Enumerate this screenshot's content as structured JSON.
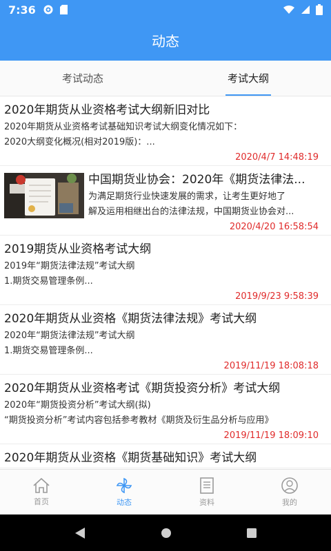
{
  "status": {
    "time": "7:36"
  },
  "appbar": {
    "title": "动态"
  },
  "tabs": [
    {
      "label": "考试动态",
      "active": false
    },
    {
      "label": "考试大纲",
      "active": true
    }
  ],
  "items": [
    {
      "title": "2020年期货从业资格考试大纲新旧对比",
      "desc1": "2020年期货从业资格考试基础知识考试大纲变化情况如下：",
      "desc2": "2020大纲变化概况(相对2019版)：...",
      "date": "2020/4/7 14:48:19"
    },
    {
      "title": "中国期货业协会：2020年《期货法律法...",
      "desc1": "为满足期货行业快速发展的需求，让考生更好地了",
      "desc2": "解及运用相继出台的法律法规，中国期货业协会对...",
      "date": "2020/4/20 16:58:54"
    },
    {
      "title": "2019期货从业资格考试大纲",
      "desc1": "2019年“期货法律法规”考试大纲",
      "desc2": "1.期货交易管理条例...",
      "date": "2019/9/23 9:58:39"
    },
    {
      "title": "2020年期货从业资格《期货法律法规》考试大纲",
      "desc1": "2020年“期货法律法规”考试大纲",
      "desc2": "1.期货交易管理条例...",
      "date": "2019/11/19 18:08:18"
    },
    {
      "title": "2020年期货从业资格考试《期货投资分析》考试大纲",
      "desc1": "2020年“期货投资分析”考试大纲(拟)",
      "desc2": "“期货投资分析”考试内容包括参考教材《期货及衍生品分析与应用》",
      "date": "2019/11/19 18:09:10"
    },
    {
      "title": "2020年期货从业资格《期货基础知识》考试大纲",
      "desc1": "",
      "desc2": "",
      "date": ""
    }
  ],
  "nav": [
    {
      "label": "首页",
      "icon": "home-icon"
    },
    {
      "label": "动态",
      "icon": "pinwheel-icon"
    },
    {
      "label": "资料",
      "icon": "document-icon"
    },
    {
      "label": "我的",
      "icon": "user-icon"
    }
  ],
  "colors": {
    "primary": "#3f97f4",
    "date": "#e02b2b"
  }
}
